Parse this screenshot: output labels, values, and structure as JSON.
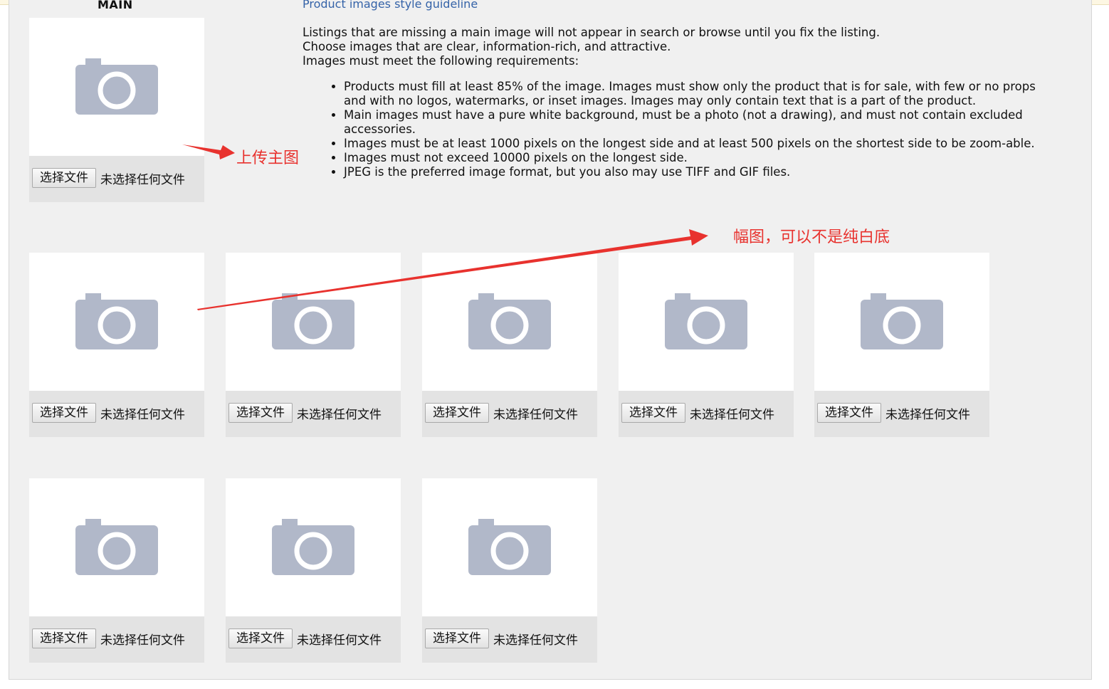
{
  "header": {
    "main_label": "MAIN",
    "guideline_link": "Product images style guideline"
  },
  "description": {
    "lines": [
      "Listings that are missing a main image will not appear in search or browse until you fix the listing.",
      "Choose images that are clear, information-rich, and attractive.",
      "Images must meet the following requirements:"
    ],
    "requirements": [
      "Products must fill at least 85% of the image. Images must show only the product that is for sale, with few or no props and with no logos, watermarks, or inset images. Images may only contain text that is a part of the product.",
      "Main images must have a pure white background, must be a photo (not a drawing), and must not contain excluded accessories.",
      "Images must be at least 1000 pixels on the longest side and at least 500 pixels on the shortest side to be zoom-able.",
      "Images must not exceed 10000 pixels on the longest side.",
      "JPEG is the preferred image format, but you also may use TIFF and GIF files."
    ]
  },
  "uploaders": {
    "main": {
      "button_label": "选择文件",
      "status": "未选择任何文件",
      "icon": "camera-icon"
    },
    "slot_1": {
      "button_label": "选择文件",
      "status": "未选择任何文件",
      "icon": "camera-icon"
    },
    "slot_2": {
      "button_label": "选择文件",
      "status": "未选择任何文件",
      "icon": "camera-icon"
    },
    "slot_3": {
      "button_label": "选择文件",
      "status": "未选择任何文件",
      "icon": "camera-icon"
    },
    "slot_4": {
      "button_label": "选择文件",
      "status": "未选择任何文件",
      "icon": "camera-icon"
    },
    "slot_5": {
      "button_label": "选择文件",
      "status": "未选择任何文件",
      "icon": "camera-icon"
    },
    "slot_6": {
      "button_label": "选择文件",
      "status": "未选择任何文件",
      "icon": "camera-icon"
    },
    "slot_7": {
      "button_label": "选择文件",
      "status": "未选择任何文件",
      "icon": "camera-icon"
    },
    "slot_8": {
      "button_label": "选择文件",
      "status": "未选择任何文件",
      "icon": "camera-icon"
    }
  },
  "annotations": {
    "main_image": "上传主图",
    "secondary_images": "幅图，可以不是纯白底"
  },
  "colors": {
    "annotation_red": "#e8322e",
    "camera_icon": "#b1b8c9",
    "link_blue": "#3563a8"
  }
}
